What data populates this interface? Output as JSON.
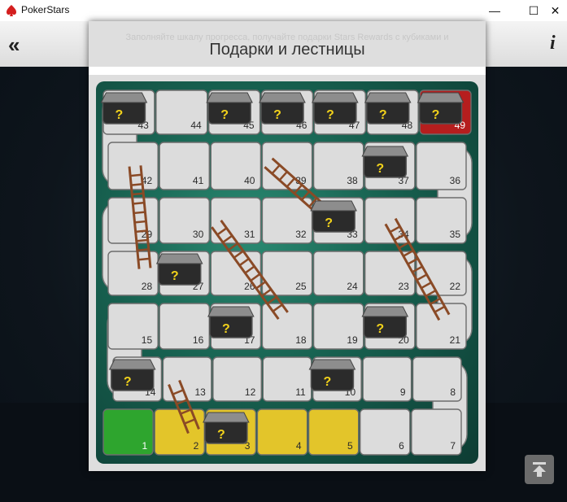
{
  "window": {
    "app_title": "PokerStars",
    "minimize": "—",
    "maximize": "☐",
    "close": "✕"
  },
  "header": {
    "back_label": "«",
    "info_label": "i"
  },
  "dialog": {
    "faded_text": "Заполняйте шкалу прогресса, получайте подарки Stars Rewards с кубиками и",
    "title": "Подарки и лестницы"
  },
  "board": {
    "total_cells": 49,
    "current_cell": 1,
    "chest_cells": [
      3,
      10,
      14,
      17,
      20,
      27,
      33,
      37,
      43,
      45,
      46,
      47,
      48,
      49
    ],
    "yellow_cells": [
      2,
      3,
      4,
      5
    ],
    "chest_glyph": "?",
    "colors": {
      "start": "#2ea52e",
      "progress": "#e3c52a",
      "finish": "#b51e1e",
      "stone": "#dcdcdc",
      "ladder": "#8a4a26"
    }
  },
  "scroll_top": {
    "icon": "arrow-up-bar-icon"
  }
}
